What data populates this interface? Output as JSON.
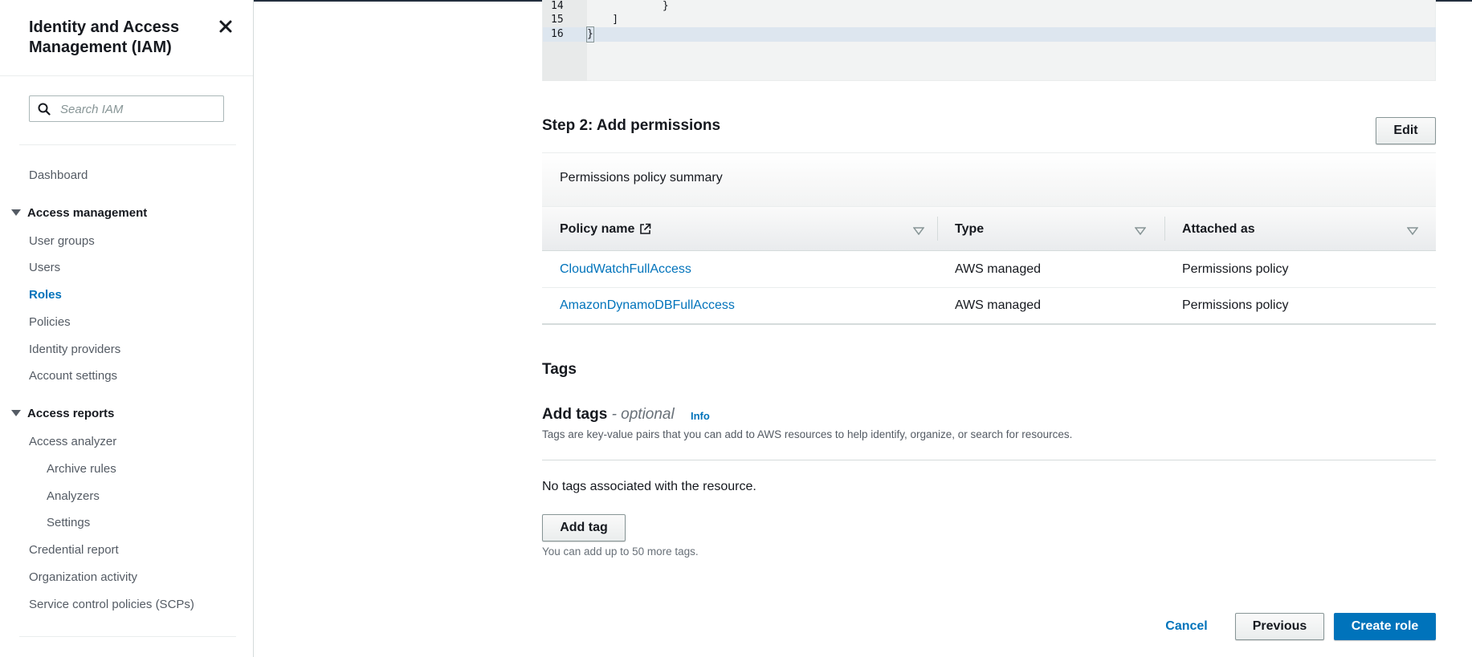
{
  "sidebar": {
    "title": "Identity and Access Management (IAM)",
    "close_icon": "close-icon",
    "search_placeholder": "Search IAM",
    "dashboard": "Dashboard",
    "access_management": {
      "label": "Access management",
      "items": [
        "User groups",
        "Users",
        "Roles",
        "Policies",
        "Identity providers",
        "Account settings"
      ],
      "active": "Roles"
    },
    "access_reports": {
      "label": "Access reports",
      "access_analyzer": "Access analyzer",
      "analyzer_children": [
        "Archive rules",
        "Analyzers",
        "Settings"
      ],
      "items": [
        "Credential report",
        "Organization activity",
        "Service control policies (SCPs)"
      ]
    }
  },
  "editor": {
    "lines": [
      {
        "num": "14",
        "text": "            }"
      },
      {
        "num": "15",
        "text": "    ]"
      },
      {
        "num": "16",
        "text": "}"
      }
    ]
  },
  "step2": {
    "title": "Step 2: Add permissions",
    "edit_label": "Edit",
    "summary_title": "Permissions policy summary",
    "columns": [
      "Policy name",
      "Type",
      "Attached as"
    ],
    "rows": [
      {
        "policy": "CloudWatchFullAccess",
        "type": "AWS managed",
        "attached": "Permissions policy"
      },
      {
        "policy": "AmazonDynamoDBFullAccess",
        "type": "AWS managed",
        "attached": "Permissions policy"
      }
    ]
  },
  "tags": {
    "section_title": "Tags",
    "add_tags_title": "Add tags",
    "optional": "- optional",
    "info": "Info",
    "description": "Tags are key-value pairs that you can add to AWS resources to help identify, organize, or search for resources.",
    "empty_text": "No tags associated with the resource.",
    "add_tag_label": "Add tag",
    "hint": "You can add up to 50 more tags."
  },
  "footer": {
    "cancel": "Cancel",
    "previous": "Previous",
    "create_role": "Create role"
  },
  "colors": {
    "accent": "#0073bb",
    "nav_dark": "#232f3e"
  }
}
